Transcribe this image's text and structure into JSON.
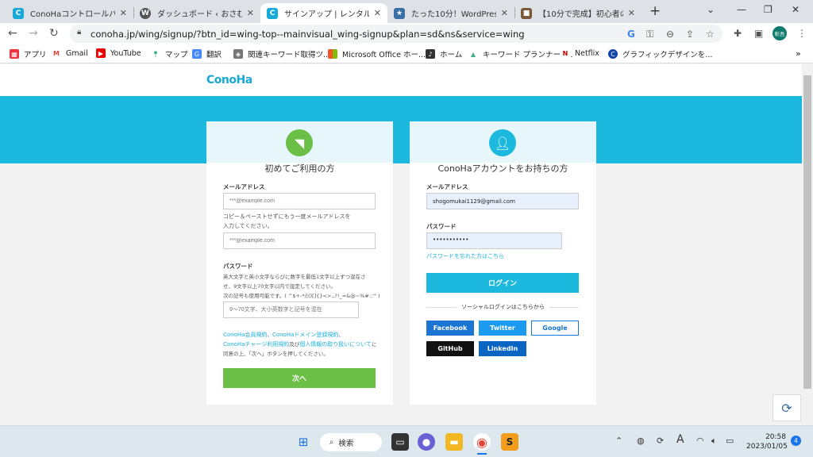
{
  "tabs": [
    {
      "title": "ConoHaコントロールパネル",
      "fav": "C",
      "color": "#19a9d6"
    },
    {
      "title": "ダッシュボード ‹ おさむブログ —",
      "fav": "W",
      "color": "#555"
    },
    {
      "title": "サインアップ | レンタルサーバー",
      "fav": "C",
      "color": "#19a9d6"
    },
    {
      "title": "たった10分！WordPressブロ",
      "fav": "★",
      "color": "#3a6ea5"
    },
    {
      "title": "【10分で完成】初心者のため",
      "fav": "■",
      "color": "#7a5a3a"
    }
  ],
  "new_tab": "+",
  "toolbar": {
    "url": "conoha.jp/wing/signup/?btn_id=wing-top--mainvisual_wing-signup&plan=sd&ns&service=wing",
    "profile": "彰吾"
  },
  "bookmarks": [
    {
      "label": "アプリ",
      "color": "#e34"
    },
    {
      "label": "Gmail",
      "color": "#d44"
    },
    {
      "label": "YouTube",
      "color": "#e00"
    },
    {
      "label": "マップ",
      "color": "#3a8"
    },
    {
      "label": "翻訳",
      "color": "#48f"
    },
    {
      "label": "関連キーワード取得ツ...",
      "color": "#777"
    },
    {
      "label": "Microsoft Office ホー...",
      "color": "#e54"
    },
    {
      "label": "ホーム",
      "color": "#333"
    },
    {
      "label": "キーワード プランナー -...",
      "color": "#4a8"
    },
    {
      "label": "Netflix",
      "color": "#c00"
    },
    {
      "label": "グラフィックデザインを...",
      "color": "#14a"
    }
  ],
  "bookmarks_more": "»",
  "page": {
    "logo": "ConoHa",
    "new_user": {
      "title": "初めてご利用の方",
      "email_label": "メールアドレス",
      "email_placeholder": "***@example.com",
      "confirm_note_1": "コピー＆ペーストせずにもう一度メールアドレスを",
      "confirm_note_2": "入力してください。",
      "confirm_placeholder": "***@example.com",
      "password_label": "パスワード",
      "password_note_1": "英大文字と英小文字ならびに数字を最低1文字以上ずつ混在さ",
      "password_note_2": "せ、9文字以上70文字以内で設定してください。",
      "password_note_3": "次の記号も使用可能です。( ^$+-*/|()[]{}<>.,?!_=&@~%#:;'\" )",
      "password_placeholder": "9～70文字、大小英数字と記号を混在",
      "terms_1": "ConoHa会員規約",
      "terms_sep": "、",
      "terms_2": "ConoHaドメイン登録規約",
      "terms_3": "ConoHaチャージ利用規約",
      "terms_and": "及び",
      "terms_4": "個人情報の取り扱いについて",
      "terms_5": "に",
      "terms_6": "同意の上、「次へ」ボタンを押してください。",
      "next_button": "次へ"
    },
    "existing_user": {
      "title": "ConoHaアカウントをお持ちの方",
      "email_label": "メールアドレス",
      "email_value": "shogomukai1129@gmail.com",
      "password_label": "パスワード",
      "password_value": "•••••••••••",
      "forgot_link": "パスワードを忘れた方はこちら",
      "login_button": "ログイン",
      "social_label": "ソーシャルログインはこちらから",
      "social": [
        {
          "label": "Facebook",
          "color": "#1a76d2"
        },
        {
          "label": "Twitter",
          "color": "#1d9bf0"
        },
        {
          "label": "Google",
          "color": "#ffffff"
        },
        {
          "label": "GitHub",
          "color": "#111111"
        },
        {
          "label": "LinkedIn",
          "color": "#0a66c2"
        }
      ]
    }
  },
  "taskbar": {
    "search_label": "検索",
    "time": "20:58",
    "date": "2023/01/05",
    "ime": "A",
    "notification_count": "4"
  },
  "colors": {
    "accent": "#1cb8de",
    "green": "#6bbf47"
  }
}
